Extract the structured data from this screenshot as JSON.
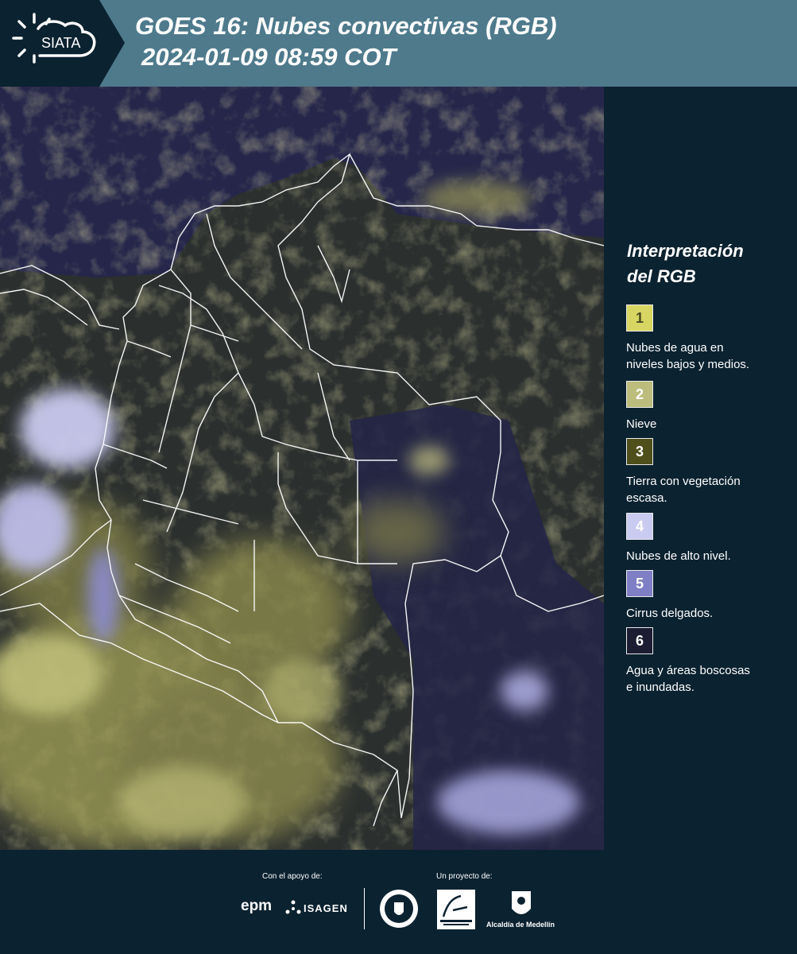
{
  "header": {
    "title_line1": "GOES 16: Nubes convectivas (RGB)",
    "title_line2": "2024-01-09 08:59 COT",
    "logo_text": "SIATA",
    "colors": {
      "banner": "#4e7a8c",
      "logo_bg": "#0b2230"
    }
  },
  "map": {
    "description_icon": "satellite-rgb-map-of-colombia",
    "colors": {
      "background": "#25264a",
      "land": "#2e3329",
      "border_lines": "#ffffff"
    }
  },
  "legend": {
    "title_line1": "Interpretación",
    "title_line2": "del RGB",
    "items": [
      {
        "number": "1",
        "label_line1": "Nubes de agua en",
        "label_line2": "niveles bajos y medios.",
        "color": "#d7d663",
        "text_color": "#4a4a20"
      },
      {
        "number": "2",
        "label_line1": "Nieve",
        "label_line2": "",
        "color": "#bcbc7c",
        "text_color": "#ffffff"
      },
      {
        "number": "3",
        "label_line1": "Tierra con vegetación",
        "label_line2": "escasa.",
        "color": "#4f4f1c",
        "text_color": "#ffffff"
      },
      {
        "number": "4",
        "label_line1": "Nubes de alto nivel.",
        "label_line2": "",
        "color": "#cacbf0",
        "text_color": "#ffffff"
      },
      {
        "number": "5",
        "label_line1": "Cirrus delgados.",
        "label_line2": "",
        "color": "#7f7fc6",
        "text_color": "#ffffff"
      },
      {
        "number": "6",
        "label_line1": "Agua y áreas boscosas",
        "label_line2": "e inundadas.",
        "color": "#1c1c33",
        "text_color": "#ffffff"
      }
    ]
  },
  "footer": {
    "support_label": "Con el apoyo de:",
    "project_label": "Un proyecto de:",
    "sponsors": [
      "epm",
      "ISAGEN"
    ],
    "partners": [
      "Área Metropolitana Valle de Aburrá",
      "Alcaldía de Medellín"
    ],
    "epm_text": "epm",
    "isagen_text": "ISAGEN",
    "alcaldia_text": "Alcaldía de Medellín"
  }
}
